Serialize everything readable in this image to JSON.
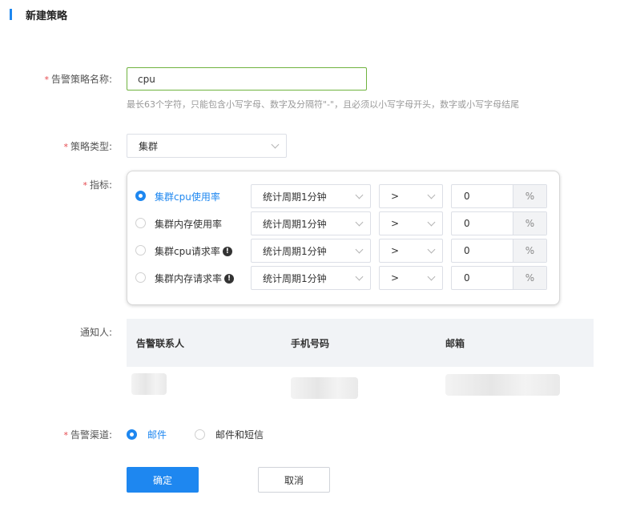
{
  "page": {
    "title": "新建策略"
  },
  "form": {
    "name": {
      "label": "告警策略名称:",
      "value": "cpu",
      "hint": "最长63个字符，只能包含小写字母、数字及分隔符\"-\"，且必须以小写字母开头，数字或小写字母结尾"
    },
    "type": {
      "label": "策略类型:",
      "value": "集群"
    },
    "metrics": {
      "label": "指标:",
      "items": [
        {
          "name": "集群cpu使用率",
          "selected": true,
          "warn": false,
          "period": "统计周期1分钟",
          "operator": ">",
          "threshold": "0",
          "unit": "%"
        },
        {
          "name": "集群内存使用率",
          "selected": false,
          "warn": false,
          "period": "统计周期1分钟",
          "operator": ">",
          "threshold": "0",
          "unit": "%"
        },
        {
          "name": "集群cpu请求率",
          "selected": false,
          "warn": true,
          "period": "统计周期1分钟",
          "operator": ">",
          "threshold": "0",
          "unit": "%"
        },
        {
          "name": "集群内存请求率",
          "selected": false,
          "warn": true,
          "period": "统计周期1分钟",
          "operator": ">",
          "threshold": "0",
          "unit": "%"
        }
      ]
    },
    "notify": {
      "label": "通知人:",
      "columns": [
        "告警联系人",
        "手机号码",
        "邮箱"
      ]
    },
    "channel": {
      "label": "告警渠道:",
      "options": [
        {
          "label": "邮件",
          "selected": true
        },
        {
          "label": "邮件和短信",
          "selected": false
        }
      ]
    }
  },
  "actions": {
    "confirm": "确定",
    "cancel": "取消"
  },
  "icons": {
    "required": "*",
    "warn": "!",
    "dropdown": "chevron-down-icon"
  },
  "colors": {
    "accent": "#1e87f0",
    "required": "#e5484d",
    "focus_border": "#6fb33f"
  }
}
